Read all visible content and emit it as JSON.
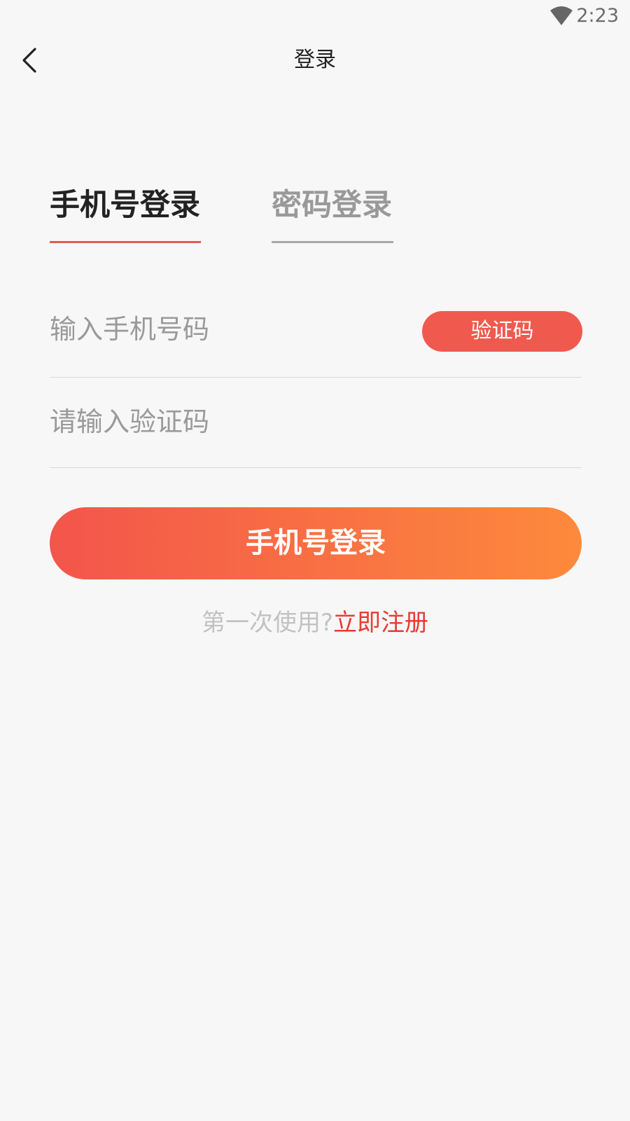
{
  "status_bar": {
    "time": "2:23",
    "wifi_icon": "wifi-icon"
  },
  "nav": {
    "back_icon": "chevron-left-icon",
    "title": "登录"
  },
  "tabs": [
    {
      "label": "手机号登录",
      "active": true
    },
    {
      "label": "密码登录",
      "active": false
    }
  ],
  "form": {
    "phone_placeholder": "输入手机号码",
    "phone_value": "",
    "code_button_label": "验证码",
    "code_placeholder": "请输入验证码",
    "code_value": ""
  },
  "login_button_label": "手机号登录",
  "register": {
    "prompt": "第一次使用?",
    "link": "立即注册"
  },
  "colors": {
    "accent": "#f05a4e",
    "gradient_start": "#f3554b",
    "gradient_end": "#fd8a3c",
    "link": "#e73c32",
    "background": "#f7f7f7"
  }
}
